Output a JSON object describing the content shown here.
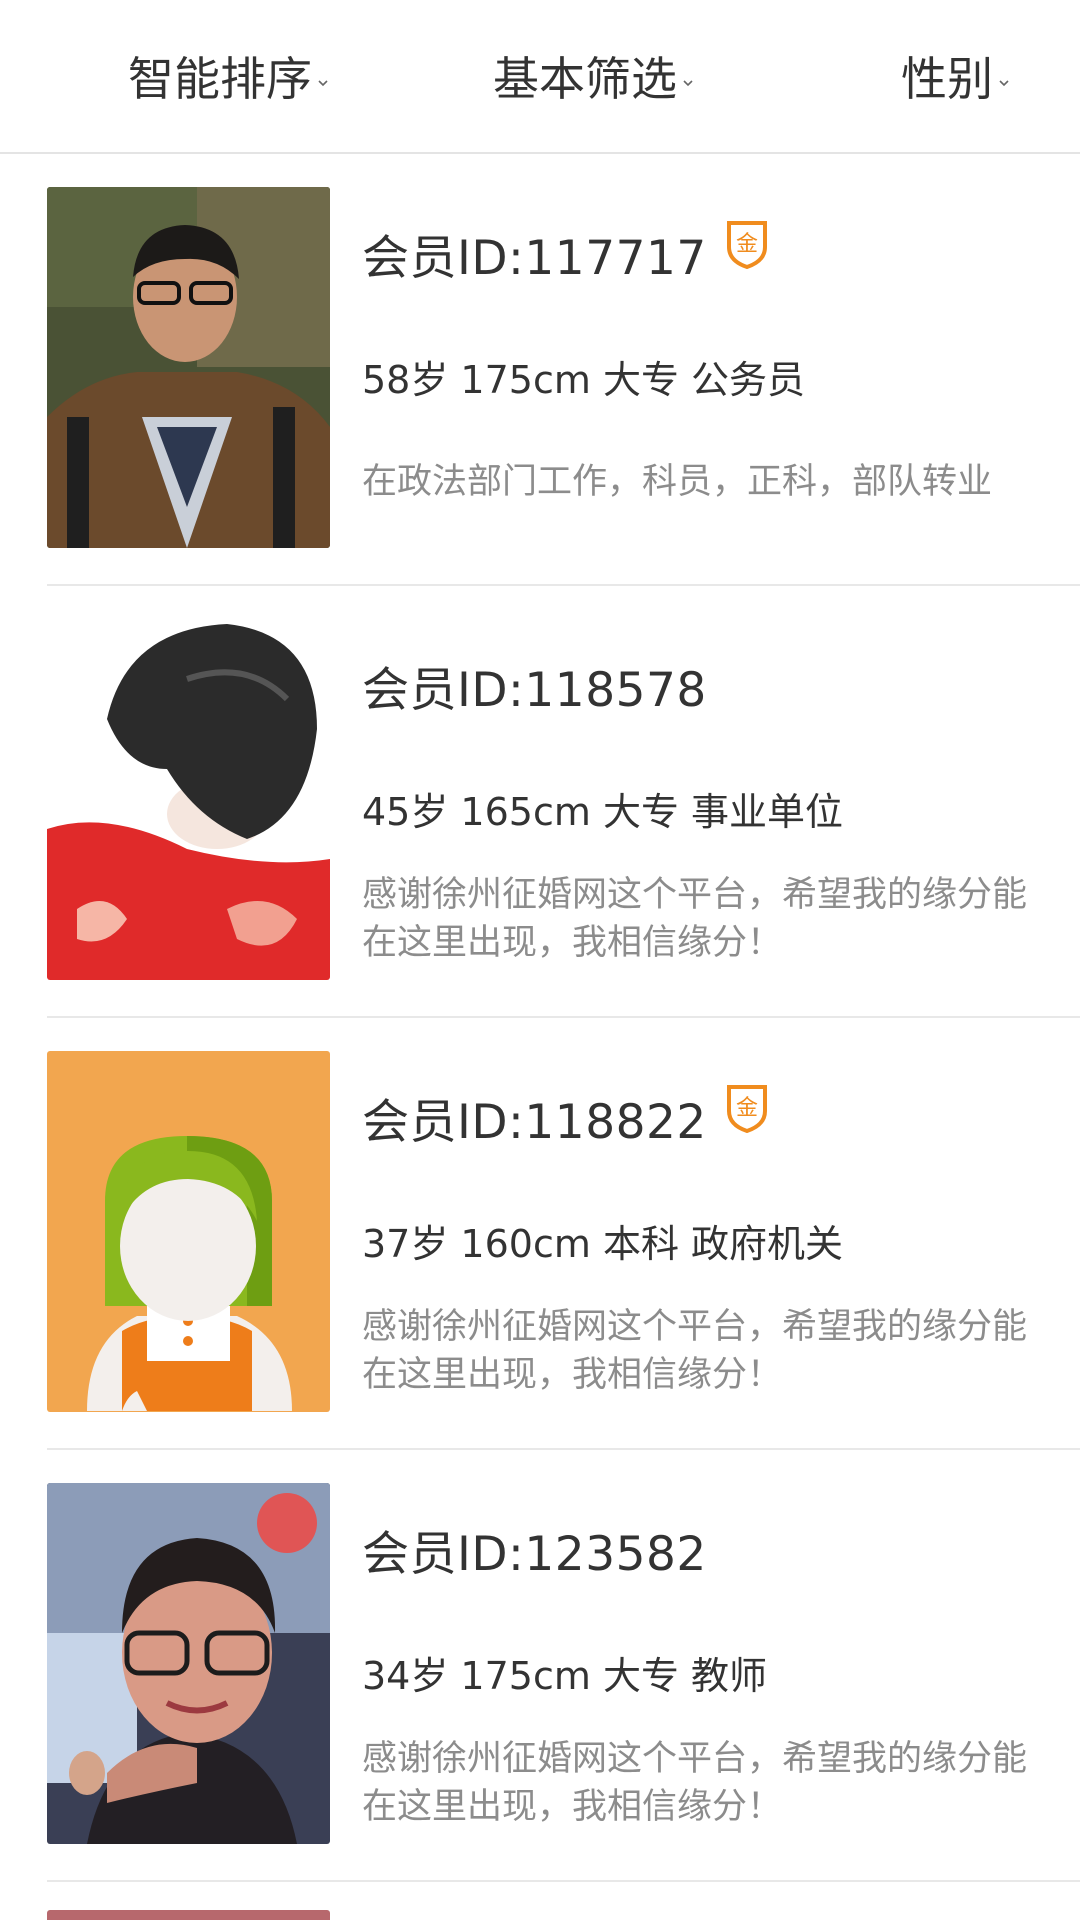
{
  "filters": {
    "sort_label": "智能排序",
    "basic_label": "基本筛选",
    "gender_label": "性别"
  },
  "members": [
    {
      "id_text": "会员ID:117717",
      "gold": true,
      "badge_char": "金",
      "info": "58岁 175cm 大专 公务员",
      "intro": "在政法部门工作，科员，正科，部队转业"
    },
    {
      "id_text": "会员ID:118578",
      "gold": false,
      "info": "45岁 165cm 大专 事业单位",
      "intro": "感谢徐州征婚网这个平台，希望我的缘分能在这里出现，我相信缘分！"
    },
    {
      "id_text": "会员ID:118822",
      "gold": true,
      "badge_char": "金",
      "info": "37岁 160cm 本科 政府机关",
      "intro": "感谢徐州征婚网这个平台，希望我的缘分能在这里出现，我相信缘分！"
    },
    {
      "id_text": "会员ID:123582",
      "gold": false,
      "info": "34岁 175cm 大专 教师",
      "intro": "感谢徐州征婚网这个平台，希望我的缘分能在这里出现，我相信缘分！"
    }
  ],
  "colors": {
    "gold_badge": "#f08c1e",
    "intro_text": "#8c8c8c",
    "default_avatar_bg": "#f2a64f"
  }
}
